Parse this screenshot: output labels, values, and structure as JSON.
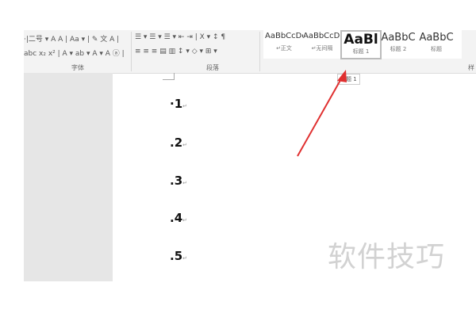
{
  "ribbon": {
    "font_row1": "·|二号 ▾ A A | Aa ▾ | ✎ 文 A |",
    "font_row2": "abc x₂ x² | A ▾ ab ▾ A ▾ A ⓐ |",
    "para_row1": "☰ ▾ ☰ ▾ ☰ ▾ ⇤ ⇥ | X ▾ ↕ ¶",
    "para_row2": "≡ ≡ ≡ ▤ ▥ ↕ ▾ ◇ ▾ ⊞ ▾",
    "font_group": "字体",
    "para_group": "段落",
    "styles_group": "样",
    "styles": [
      {
        "sample": "AaBbCcDc",
        "label": "↵正文"
      },
      {
        "sample": "AaBbCcDc",
        "label": "↵无间隔"
      },
      {
        "sample": "AaBl",
        "label": "标题 1"
      },
      {
        "sample": "AaBbC",
        "label": "标题 2"
      },
      {
        "sample": "AaBbC",
        "label": "标题"
      }
    ]
  },
  "tooltip": "标题 1",
  "document": {
    "items": [
      "1",
      "2",
      "3",
      "4",
      "5"
    ],
    "mark": "↵"
  },
  "watermark": "软件技巧",
  "colors": {
    "arrow": "#e03030"
  }
}
